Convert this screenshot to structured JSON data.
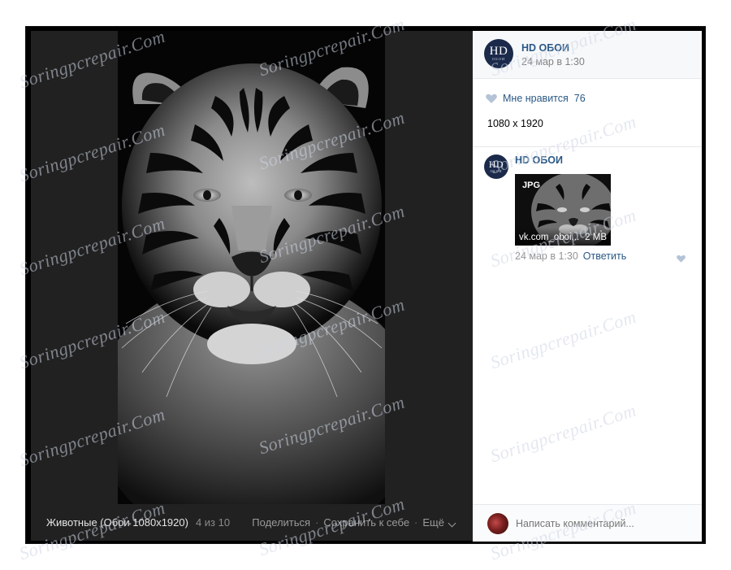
{
  "viewer": {
    "footer": {
      "album_title": "Животные (Обои 1080x1920)",
      "photo_counter": "4 из 10",
      "share_label": "Поделиться",
      "separator": "·",
      "save_label": "Сохранить к себе",
      "more_label": "Ещё"
    }
  },
  "post": {
    "group_name": "HD ОБОИ",
    "date": "24 мар в 1:30",
    "avatar_text": "HD",
    "avatar_subtext": "ОБОИ",
    "likes_label": "Мне нравится",
    "likes_count": "76",
    "description": "1080 x 1920"
  },
  "comment": {
    "author": "HD ОБОИ",
    "avatar_text": "HD",
    "avatar_subtext": "ОБОИ",
    "attachment": {
      "badge": "JPG",
      "filename": "vk.com_oboi...",
      "size": "2 MB"
    },
    "date": "24 мар в 1:30",
    "reply_label": "Ответить"
  },
  "compose": {
    "placeholder": "Написать комментарий..."
  },
  "watermark": {
    "text": "Soringpcrepair.Com"
  },
  "colors": {
    "link": "#2a5885",
    "viewer_bg": "#212121",
    "like_icon": "#b4c3d6"
  }
}
